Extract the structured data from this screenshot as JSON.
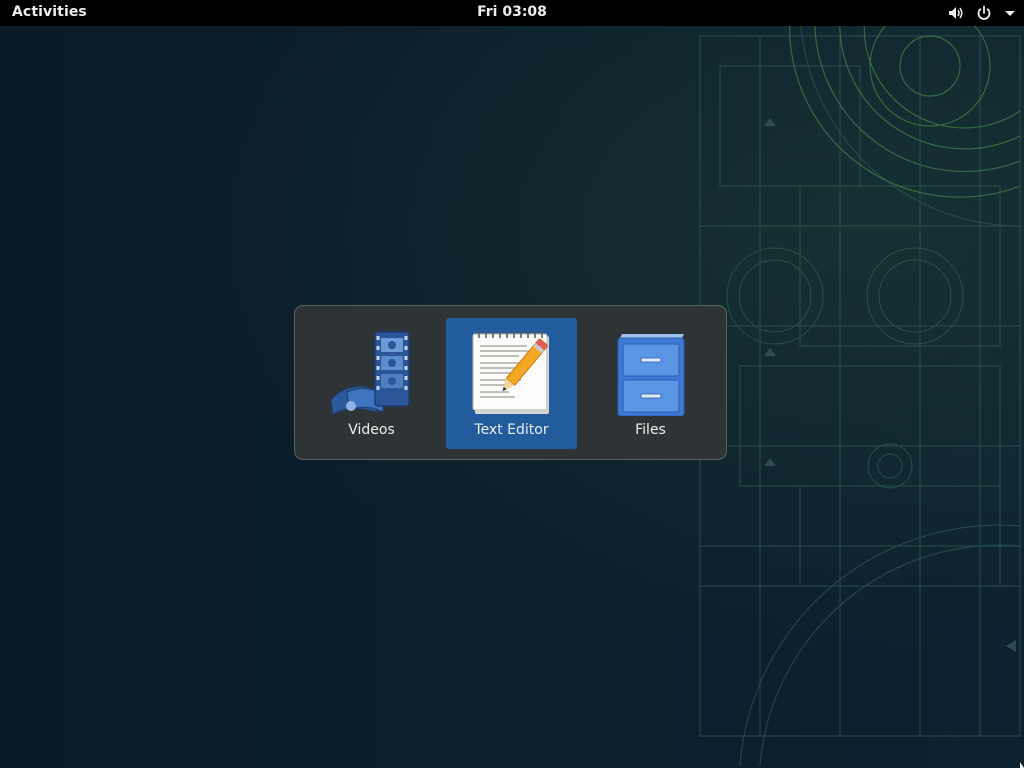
{
  "topbar": {
    "activities_label": "Activities",
    "clock": "Fri 03:08",
    "tray_icons": [
      "volume-icon",
      "power-icon",
      "dropdown-arrow-icon"
    ]
  },
  "switcher": {
    "apps": [
      {
        "label": "Videos",
        "icon": "videos-icon",
        "selected": false
      },
      {
        "label": "Text Editor",
        "icon": "text-editor-icon",
        "selected": true
      },
      {
        "label": "Files",
        "icon": "files-icon",
        "selected": false
      }
    ]
  },
  "colors": {
    "panel": "#000000",
    "switcher_bg": "#2e3436",
    "selection": "#215d9c",
    "desktop_bg": "#0b1d2a"
  }
}
